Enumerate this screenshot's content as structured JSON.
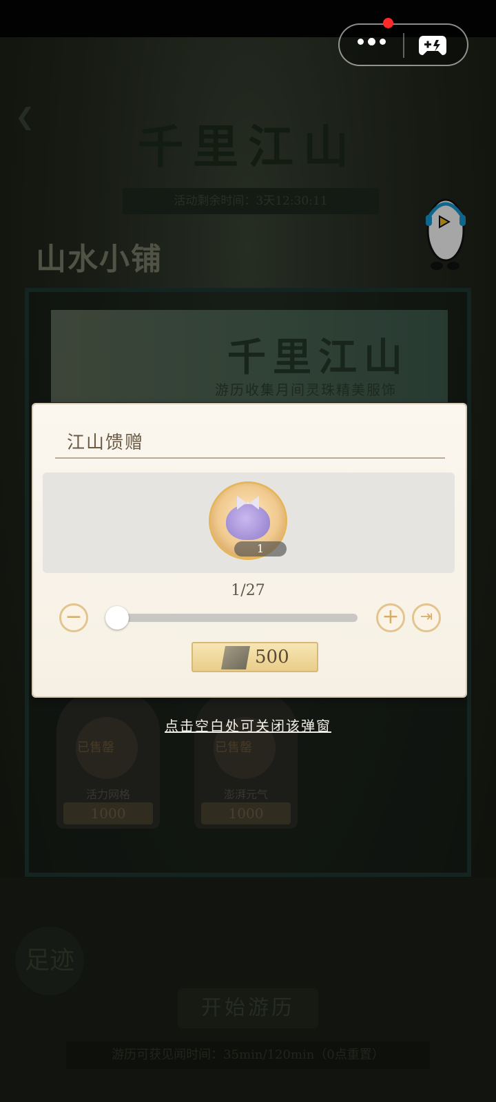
{
  "system_bar": {
    "menu_icon": "more-dots-icon",
    "game_icon": "gamepad-icon",
    "notification_color": "#ff2b2b"
  },
  "background": {
    "title": "千里江山",
    "timer": "活动剩余时间：3天12:30:11",
    "shop_label": "山水小铺",
    "banner_title": "千里江山",
    "banner_subtitle": "游历收集月间灵珠精美服饰",
    "cards": [
      {
        "status": "已售罄",
        "name": "活力网格",
        "price": "1000"
      },
      {
        "status": "已售罄",
        "name": "澎湃元气",
        "price": "1000"
      }
    ],
    "footprint": "足迹",
    "start_button": "开始游历",
    "footer": "游历可获见闻时间：35min/120min（0点重置）"
  },
  "dialog": {
    "title": "江山馈赠",
    "item_qty": "1",
    "count": "1/27",
    "minus_icon": "minus-icon",
    "plus_icon": "plus-icon",
    "max_icon": "skip-to-max-icon",
    "slider_fraction": 0.0,
    "price": "500"
  },
  "close_hint": "点击空白处可关闭该弹窗"
}
